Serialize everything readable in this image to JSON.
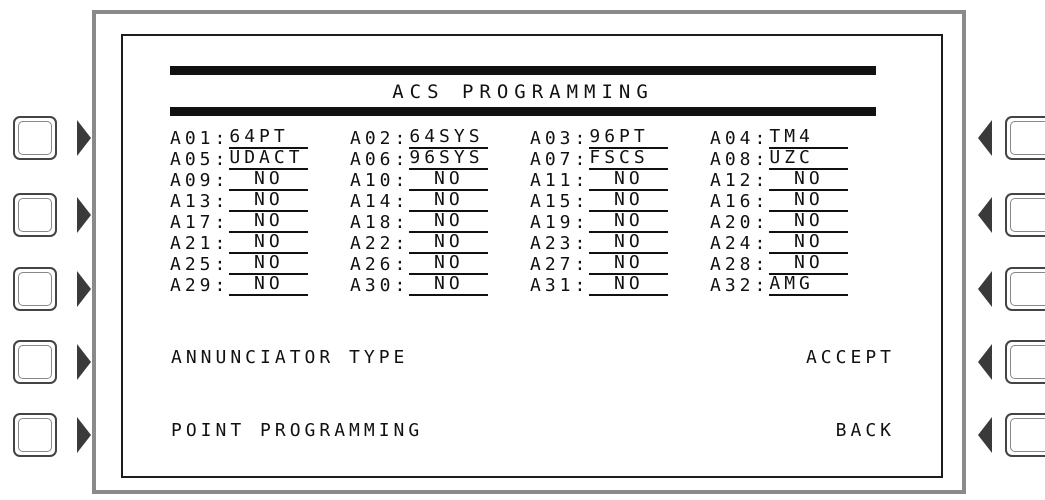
{
  "screen": {
    "title": "ACS PROGRAMMING"
  },
  "assignments": [
    [
      {
        "addr": "A01:",
        "val": "64PT"
      },
      {
        "addr": "A02:",
        "val": "64SYS"
      },
      {
        "addr": "A03:",
        "val": "96PT"
      },
      {
        "addr": "A04:",
        "val": "TM4"
      }
    ],
    [
      {
        "addr": "A05:",
        "val": "UDACT"
      },
      {
        "addr": "A06:",
        "val": "96SYS"
      },
      {
        "addr": "A07:",
        "val": "FSCS"
      },
      {
        "addr": "A08:",
        "val": "UZC"
      }
    ],
    [
      {
        "addr": "A09:",
        "val": "NO"
      },
      {
        "addr": "A10:",
        "val": "NO"
      },
      {
        "addr": "A11:",
        "val": "NO"
      },
      {
        "addr": "A12:",
        "val": "NO"
      }
    ],
    [
      {
        "addr": "A13:",
        "val": "NO"
      },
      {
        "addr": "A14:",
        "val": "NO"
      },
      {
        "addr": "A15:",
        "val": "NO"
      },
      {
        "addr": "A16:",
        "val": "NO"
      }
    ],
    [
      {
        "addr": "A17:",
        "val": "NO"
      },
      {
        "addr": "A18:",
        "val": "NO"
      },
      {
        "addr": "A19:",
        "val": "NO"
      },
      {
        "addr": "A20:",
        "val": "NO"
      }
    ],
    [
      {
        "addr": "A21:",
        "val": "NO"
      },
      {
        "addr": "A22:",
        "val": "NO"
      },
      {
        "addr": "A23:",
        "val": "NO"
      },
      {
        "addr": "A24:",
        "val": "NO"
      }
    ],
    [
      {
        "addr": "A25:",
        "val": "NO"
      },
      {
        "addr": "A26:",
        "val": "NO"
      },
      {
        "addr": "A27:",
        "val": "NO"
      },
      {
        "addr": "A28:",
        "val": "NO"
      }
    ],
    [
      {
        "addr": "A29:",
        "val": "NO"
      },
      {
        "addr": "A30:",
        "val": "NO"
      },
      {
        "addr": "A31:",
        "val": "NO"
      },
      {
        "addr": "A32:",
        "val": "AMG"
      }
    ]
  ],
  "menu": {
    "annunciator_type": "ANNUNCIATOR TYPE",
    "point_programming": "POINT PROGRAMMING",
    "accept": "ACCEPT",
    "back": "BACK"
  },
  "softkeys": {
    "left_icon": "softkey-right-arrow-icon",
    "right_icon": "softkey-left-arrow-icon"
  }
}
